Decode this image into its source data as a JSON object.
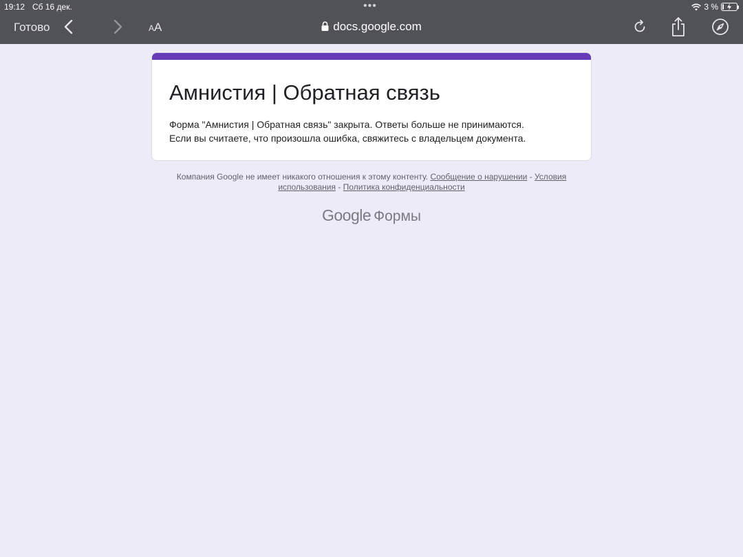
{
  "status": {
    "time": "19:12",
    "date": "Сб 16 дек.",
    "battery": "3 %"
  },
  "browser": {
    "done_label": "Готово",
    "text_size_small": "A",
    "text_size_large": "A",
    "url": "docs.google.com",
    "icons": [
      "chevron-left-icon",
      "chevron-right-icon",
      "lock-icon",
      "reload-icon",
      "share-icon",
      "compass-icon",
      "wifi-icon",
      "battery-icon"
    ]
  },
  "form": {
    "accent_color": "#673ab7",
    "title": "Амнистия | Обратная связь",
    "message_line1": "Форма \"Амнистия | Обратная связь\" закрыта. Ответы больше не принимаются.",
    "message_line2": "Если вы считаете, что произошла ошибка, свяжитесь с владельцем документа."
  },
  "footer": {
    "disclaimer": "Компания Google не имеет никакого отношения к этому контенту.",
    "report_link": "Сообщение о нарушении",
    "sep1": "-",
    "terms_link_part1": "Условия",
    "terms_link_part2": "использования",
    "sep2": "-",
    "privacy_link": "Политика конфиденциальности",
    "brand_google": "Google",
    "brand_forms": "Формы"
  }
}
